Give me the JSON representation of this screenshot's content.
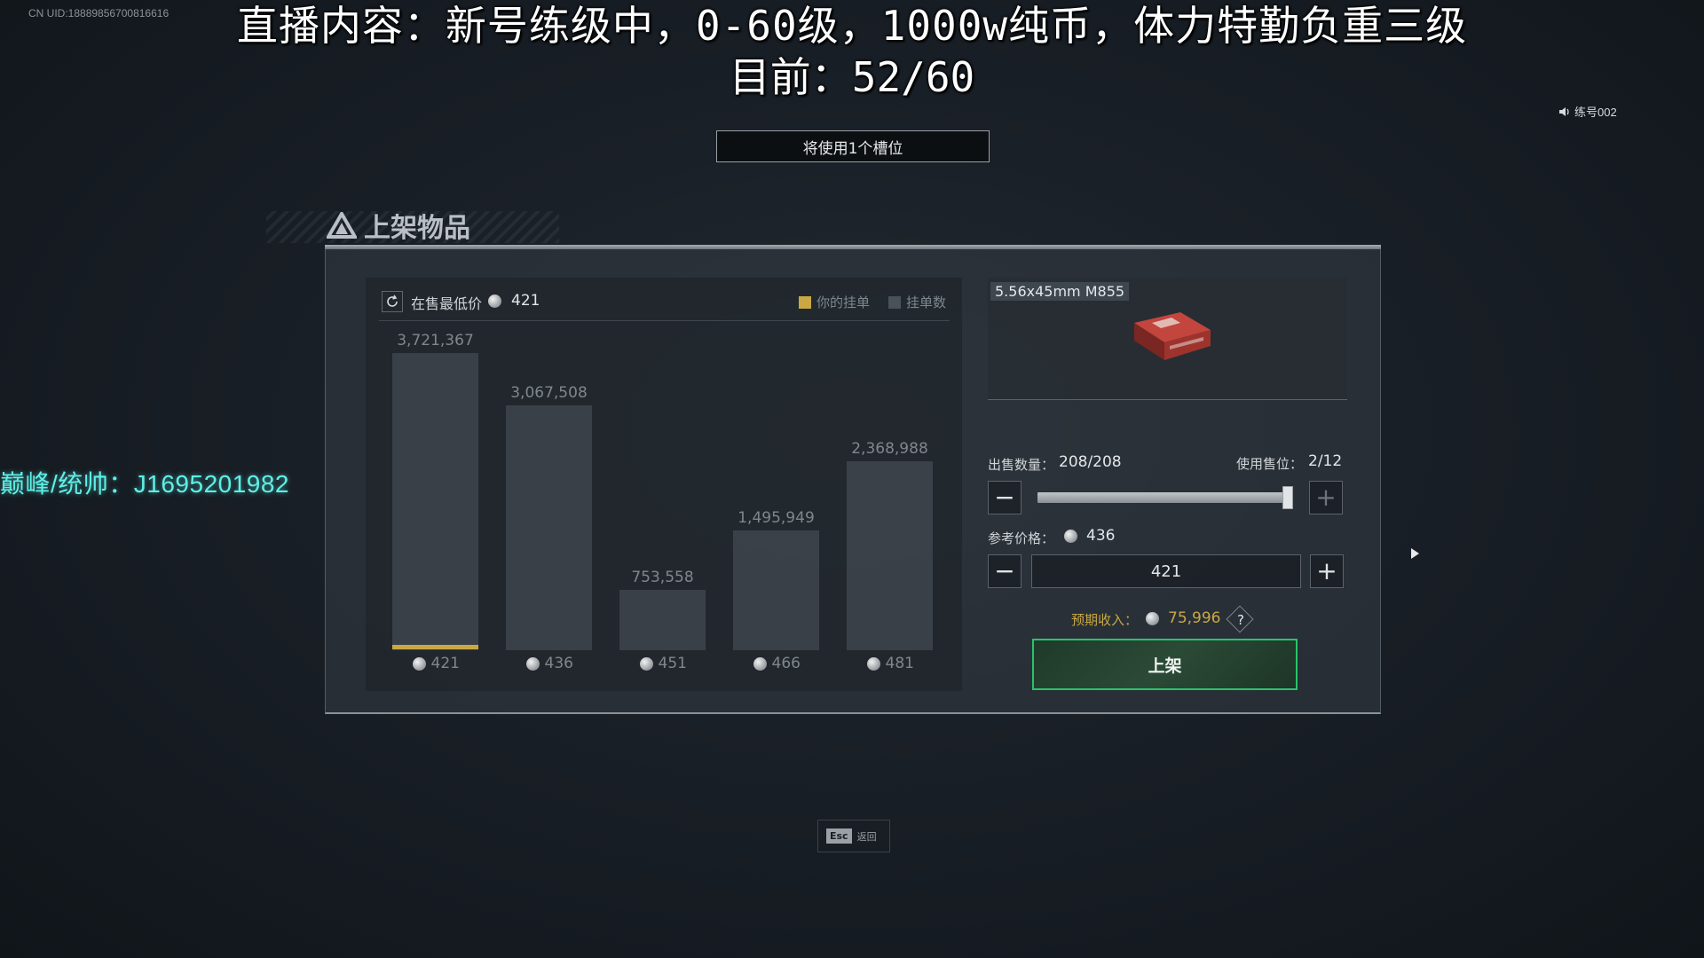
{
  "overlay": {
    "uid": "CN UID:18889856700816616",
    "stream_line1": "直播内容：新号练级中，0-60级，1000w纯币，体力特勤负重三级",
    "stream_line2": "目前：52/60",
    "voice_label": "练号002",
    "side_text": "巅峰/统帅：J1695201982"
  },
  "slot_banner": "将使用1个槽位",
  "panel": {
    "title": "上架物品"
  },
  "market": {
    "lowest_label": "在售最低价",
    "lowest_price": "421",
    "legend_yours": "你的挂单",
    "legend_count": "挂单数",
    "colors": {
      "yours": "#c9a844",
      "count": "#4a5259"
    }
  },
  "chart_data": {
    "type": "bar",
    "title": "",
    "xlabel": "",
    "ylabel": "",
    "categories": [
      "421",
      "436",
      "451",
      "466",
      "481"
    ],
    "value_labels": [
      "3,721,367",
      "3,067,508",
      "753,558",
      "1,495,949",
      "2,368,988"
    ],
    "series": [
      {
        "name": "挂单数",
        "values": [
          3721367,
          3067508,
          753558,
          1495949,
          2368988
        ]
      }
    ],
    "your_listing_category": "421",
    "ylim": [
      0,
      3721367
    ],
    "grid": false,
    "legend": "top-right"
  },
  "item": {
    "name": "5.56x45mm M855"
  },
  "sell": {
    "qty_label": "出售数量：",
    "qty_value": "208/208",
    "slots_label": "使用售位：",
    "slots_value": "2/12",
    "qty_fraction": 1.0,
    "ref_label": "参考价格：",
    "ref_value": "436",
    "price_value": "421",
    "income_label": "预期收入：",
    "income_value": "75,996",
    "help_symbol": "?",
    "list_button": "上架"
  },
  "footer": {
    "esc_key": "Esc",
    "esc_label": "返回"
  }
}
